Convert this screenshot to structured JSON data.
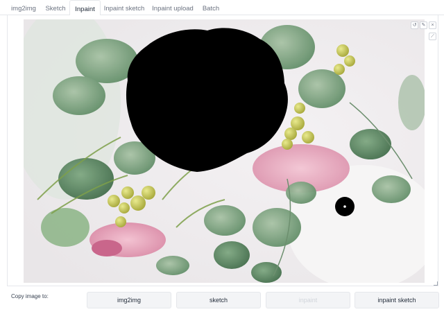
{
  "tabs": [
    {
      "label": "img2img",
      "active": false
    },
    {
      "label": "Sketch",
      "active": false
    },
    {
      "label": "Inpaint",
      "active": true
    },
    {
      "label": "Inpaint sketch",
      "active": false
    },
    {
      "label": "Inpaint upload",
      "active": false
    },
    {
      "label": "Batch",
      "active": false
    }
  ],
  "canvas": {
    "tools": {
      "undo_icon": "↺",
      "clear_icon": "✎",
      "close_icon": "×",
      "brush_icon": "⟋"
    }
  },
  "copy_image": {
    "label": "Copy image to:",
    "buttons": [
      {
        "label": "img2img",
        "enabled": true
      },
      {
        "label": "sketch",
        "enabled": true
      },
      {
        "label": "inpaint",
        "enabled": false
      },
      {
        "label": "inpaint sketch",
        "enabled": true
      }
    ]
  },
  "colors": {
    "accent": "#f97316",
    "mask": "#000000",
    "tab_text": "#6b7280"
  }
}
